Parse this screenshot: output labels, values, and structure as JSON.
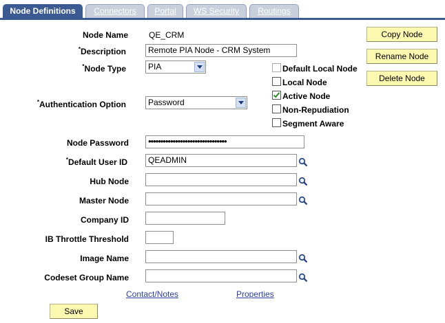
{
  "tabs": [
    {
      "label": "Node Definitions",
      "active": true
    },
    {
      "label": "Connectors",
      "active": false
    },
    {
      "label": "Portal",
      "active": false
    },
    {
      "label": "WS Security",
      "active": false
    },
    {
      "label": "Routings",
      "active": false
    }
  ],
  "fields": {
    "node_name": {
      "label": "Node Name",
      "value": "QE_CRM"
    },
    "description": {
      "label": "Description",
      "value": "Remote PIA Node - CRM System",
      "required": true
    },
    "node_type": {
      "label": "Node Type",
      "value": "PIA",
      "required": true
    },
    "auth_option": {
      "label": "Authentication Option",
      "value": "Password",
      "required": true
    },
    "node_password": {
      "label": "Node Password",
      "value": "••••••••••••••••••••••••••••••••"
    },
    "default_user_id": {
      "label": "Default User ID",
      "value": "QEADMIN",
      "required": true
    },
    "hub_node": {
      "label": "Hub Node",
      "value": ""
    },
    "master_node": {
      "label": "Master Node",
      "value": ""
    },
    "company_id": {
      "label": "Company ID",
      "value": ""
    },
    "ib_throttle": {
      "label": "IB Throttle Threshold",
      "value": ""
    },
    "image_name": {
      "label": "Image Name",
      "value": ""
    },
    "codeset_group": {
      "label": "Codeset Group Name",
      "value": ""
    }
  },
  "required_marker": "*",
  "checkboxes": {
    "default_local_node": {
      "label": "Default Local Node",
      "checked": false,
      "disabled": true
    },
    "local_node": {
      "label": "Local Node",
      "checked": false
    },
    "active_node": {
      "label": "Active Node",
      "checked": true
    },
    "non_repudiation": {
      "label": "Non-Repudiation",
      "checked": false
    },
    "segment_aware": {
      "label": "Segment Aware",
      "checked": false
    }
  },
  "buttons": {
    "copy_node": "Copy Node",
    "rename_node": "Rename Node",
    "delete_node": "Delete Node",
    "save": "Save"
  },
  "links": {
    "contact_notes": "Contact/Notes",
    "properties": "Properties"
  },
  "colors": {
    "tab_active": "#3c5a92",
    "tab_inactive": "#c9d0dc",
    "button_bg": "#fbf8b0",
    "link": "#2a3fa0",
    "checkmark": "#2e8b2e"
  }
}
